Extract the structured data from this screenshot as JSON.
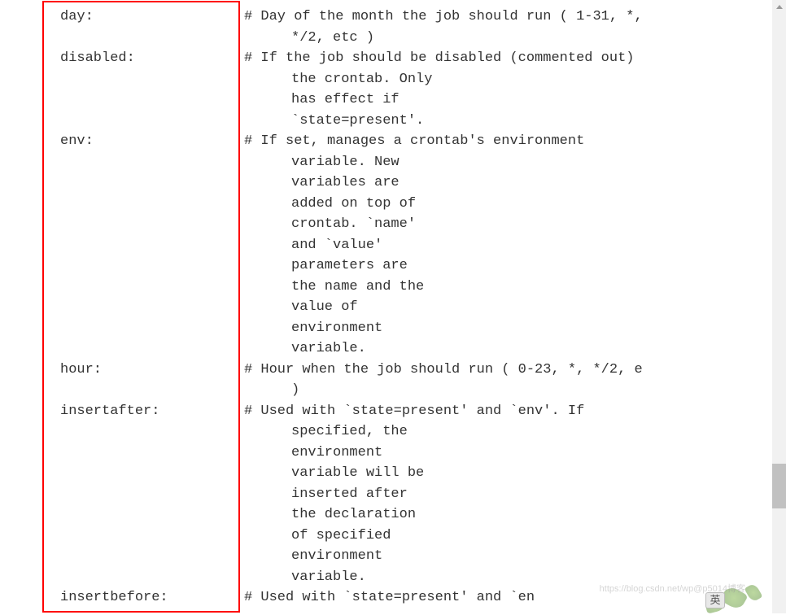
{
  "params": [
    {
      "name": "day:",
      "desc": "# Day of the month the job should run ( 1-31, *,",
      "cont": [
        "*/2, etc )"
      ]
    },
    {
      "name": "disabled:",
      "desc": "# If the job should be disabled (commented out)",
      "cont": [
        "the crontab. Only",
        "has effect if",
        "`state=present'."
      ]
    },
    {
      "name": "env:",
      "desc": "# If set, manages a crontab's environment",
      "cont": [
        "variable. New",
        "variables are",
        "added on top of",
        "crontab. `name'",
        "and `value'",
        "parameters are",
        "the name and the",
        "value of",
        "environment",
        "variable."
      ]
    },
    {
      "name": "hour:",
      "desc": "# Hour when the job should run ( 0-23, *, */2, e",
      "cont": [
        ")"
      ]
    },
    {
      "name": "insertafter:",
      "desc": "# Used with `state=present' and `env'. If",
      "cont": [
        "specified, the",
        "environment",
        "variable will be",
        "inserted after",
        "the declaration",
        "of specified",
        "environment",
        "variable."
      ]
    },
    {
      "name": "insertbefore:",
      "desc": "# Used with `state=present' and `en",
      "cont": []
    }
  ],
  "watermark": "https://blog.csdn.net/wp@p5014博客",
  "ime": "英"
}
